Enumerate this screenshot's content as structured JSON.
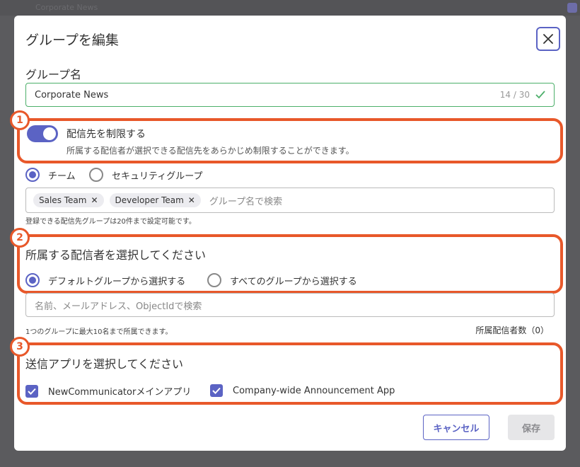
{
  "background": {
    "title": "Corporate News"
  },
  "dialog": {
    "title": "グループを編集",
    "name_label": "グループ名",
    "name_value": "Corporate News",
    "name_counter": "14 / 30",
    "restrict": {
      "title": "配信先を制限する",
      "description": "所属する配信者が選択できる配信先をあらかじめ制限することができます。",
      "enabled": true
    },
    "target_type": {
      "options": [
        "チーム",
        "セキュリティグループ"
      ],
      "selected": "チーム"
    },
    "tags": [
      "Sales Team",
      "Developer Team"
    ],
    "tag_placeholder": "グループ名で検索",
    "tag_hint": "登録できる配信先グループは20件まで設定可能です。",
    "members": {
      "title": "所属する配信者を選択してください",
      "options": [
        "デフォルトグループから選択する",
        "すべてのグループから選択する"
      ],
      "selected": "デフォルトグループから選択する",
      "search_placeholder": "名前、メールアドレス、ObjectIdで検索",
      "hint": "1つのグループに最大10名まで所属できます。",
      "count_label": "所属配信者数（0）"
    },
    "apps": {
      "title": "送信アプリを選択してください",
      "items": [
        "NewCommunicatorメインアプリ",
        "Company-wide Announcement App"
      ]
    },
    "cancel_label": "キャンセル",
    "save_label": "保存"
  },
  "callouts": [
    "1",
    "2",
    "3"
  ],
  "colors": {
    "accent": "#5b63c4",
    "callout": "#e8582a",
    "valid": "#4caf6a"
  }
}
